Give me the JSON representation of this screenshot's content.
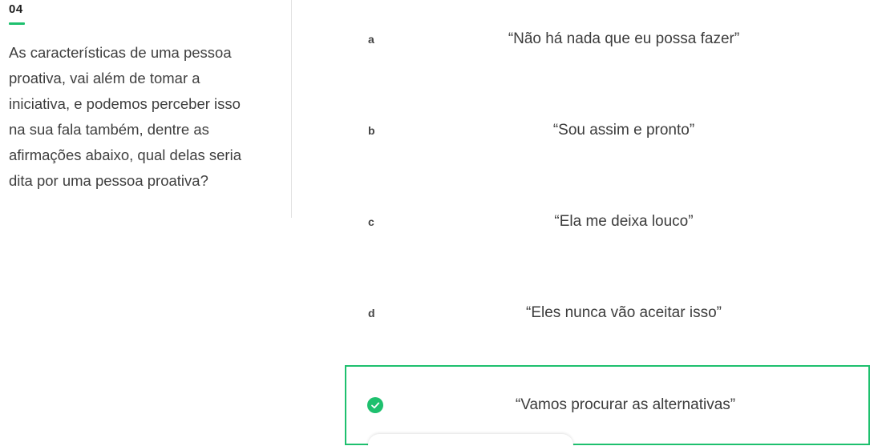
{
  "question": {
    "number": "04",
    "text": "As características de uma pessoa proativa, vai além de tomar a iniciativa, e podemos perceber isso na sua fala também, dentre as afirmações abaixo, qual delas seria dita por uma pessoa proativa?"
  },
  "options": [
    {
      "letter": "a",
      "text": "“Não há nada que eu possa fazer”",
      "selected": false
    },
    {
      "letter": "b",
      "text": "“Sou assim e pronto”",
      "selected": false
    },
    {
      "letter": "c",
      "text": "“Ela me deixa louco”",
      "selected": false
    },
    {
      "letter": "d",
      "text": "“Eles nunca vão aceitar isso”",
      "selected": false
    },
    {
      "letter": "",
      "text": "“Vamos procurar as alternativas”",
      "selected": true,
      "icon": "check-circle-icon"
    }
  ],
  "colors": {
    "accent": "#1ec06e",
    "text": "#3c3c3c",
    "divider": "#e3e3e3"
  }
}
